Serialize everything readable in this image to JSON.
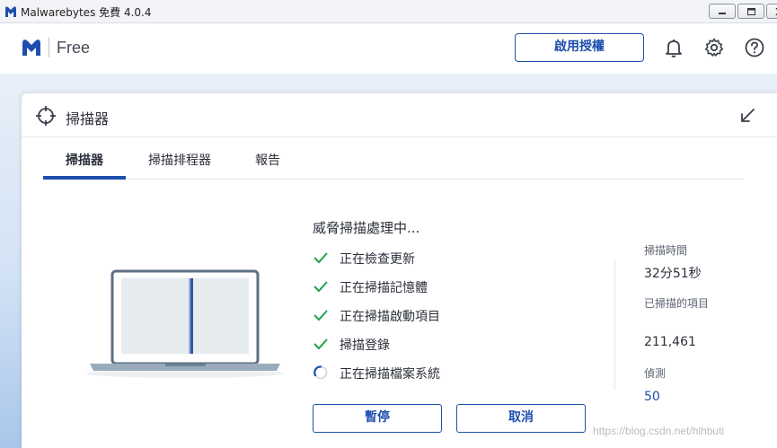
{
  "window": {
    "title": "Malwarebytes 免費  4.0.4",
    "controls": [
      "minimize",
      "restore",
      "close"
    ]
  },
  "header": {
    "brand": "Free",
    "activate_label": "啟用授權",
    "icons": [
      "bell-icon",
      "gear-icon",
      "help-icon"
    ]
  },
  "panel": {
    "title": "掃描器",
    "tabs": [
      {
        "label": "掃描器",
        "active": true
      },
      {
        "label": "掃描排程器",
        "active": false
      },
      {
        "label": "報告",
        "active": false
      }
    ]
  },
  "scan": {
    "status_title": "威脅掃描處理中...",
    "steps": [
      {
        "label": "正在檢查更新",
        "state": "done"
      },
      {
        "label": "正在掃描記憶體",
        "state": "done"
      },
      {
        "label": "正在掃描啟動項目",
        "state": "done"
      },
      {
        "label": "掃描登錄",
        "state": "done"
      },
      {
        "label": "正在掃描檔案系統",
        "state": "in-progress"
      }
    ],
    "pause_label": "暫停",
    "cancel_label": "取消"
  },
  "stats": {
    "time_label": "掃描時間",
    "time_value": "32分51秒",
    "scanned_label": "已掃描的項目",
    "scanned_value": "211,461",
    "detected_label": "偵測",
    "detected_value": "50"
  },
  "watermark": "https://blog.csdn.net/hlhbuti",
  "colors": {
    "accent": "#1e4fae",
    "check": "#1fa34a",
    "text": "#2b2f3a"
  }
}
